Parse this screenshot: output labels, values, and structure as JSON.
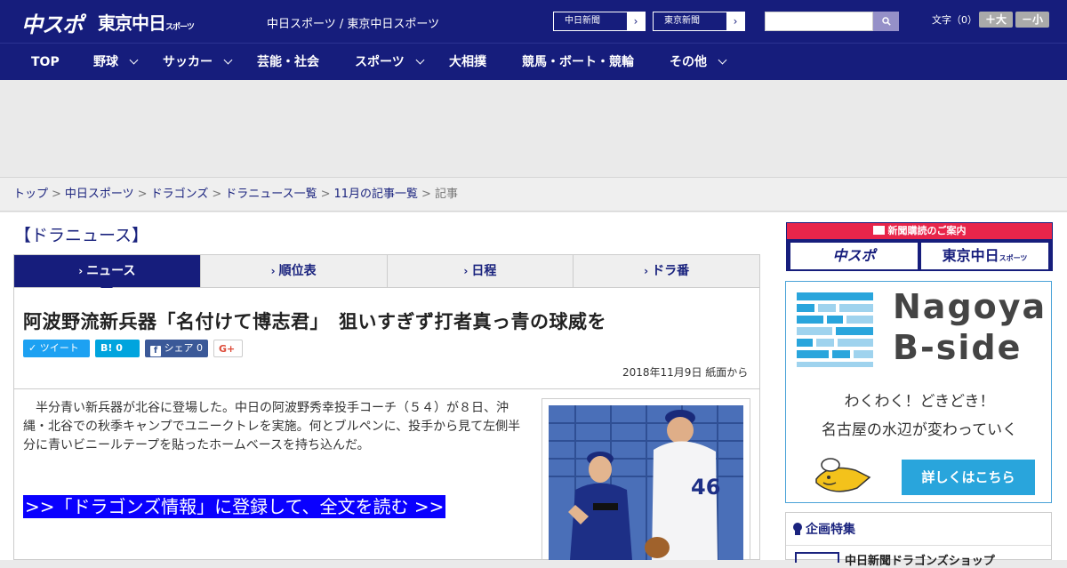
{
  "header": {
    "logo_main": "中スポ",
    "logo_tokyo": "東京中日",
    "logo_tokyo_small": "スポーツ",
    "site_names": "中日スポーツ / 東京中日スポーツ",
    "ext_links": [
      {
        "label": "中日新聞"
      },
      {
        "label": "東京新聞"
      }
    ],
    "search": {
      "placeholder": "",
      "button_icon": "search-icon"
    },
    "font_size": {
      "label": "文字（0）",
      "bigger": "＋大",
      "smaller": "－小"
    }
  },
  "nav": {
    "items": [
      {
        "label": "TOP",
        "has_dropdown": false
      },
      {
        "label": "野球",
        "has_dropdown": true
      },
      {
        "label": "サッカー",
        "has_dropdown": true
      },
      {
        "label": "芸能・社会",
        "has_dropdown": false
      },
      {
        "label": "スポーツ",
        "has_dropdown": true
      },
      {
        "label": "大相撲",
        "has_dropdown": false
      },
      {
        "label": "競馬・ボート・競輪",
        "has_dropdown": false
      },
      {
        "label": "その他",
        "has_dropdown": true
      }
    ]
  },
  "breadcrumb": {
    "items": [
      {
        "label": "トップ"
      },
      {
        "label": "中日スポーツ"
      },
      {
        "label": "ドラゴンズ"
      },
      {
        "label": "ドラニュース一覧"
      },
      {
        "label": "11月の記事一覧"
      }
    ],
    "separator": ">",
    "current": "記事"
  },
  "section": {
    "title": "【ドラニュース】"
  },
  "tabs": [
    {
      "label": "ニュース",
      "active": true
    },
    {
      "label": "順位表",
      "active": false
    },
    {
      "label": "日程",
      "active": false
    },
    {
      "label": "ドラ番",
      "active": false
    }
  ],
  "article": {
    "headline": "阿波野流新兵器「名付けて博志君」　狙いすぎず打者真っ青の球威を",
    "share": {
      "tweet": "ツイート",
      "hatena": "B! 0",
      "facebook": "シェア 0",
      "gplus": "G+"
    },
    "date": "2018年11月9日 紙面から",
    "body": "　半分青い新兵器が北谷に登場した。中日の阿波野秀幸投手コーチ（５４）が８日、沖縄・北谷での秋季キャンプでユニークトレを実施。何とブルペンに、投手から見て左側半分に青いビニールテープを貼ったホームベースを持ち込んだ。",
    "cta": ">>「ドラゴンズ情報」に登録して、全文を読む >>",
    "photo_number": "46"
  },
  "sidebar": {
    "subscription": {
      "header": "新聞購読のご案内",
      "left": "中スポ",
      "right": "東京中日",
      "right_small": "スポーツ"
    },
    "ad": {
      "title_line1": "Nagoya",
      "title_line2": "B-side",
      "tagline1": "わくわく！どきどき！",
      "tagline2": "名古屋の水辺が変わっていく",
      "button": "詳しくはこちら"
    },
    "feature": {
      "header": "企画特集",
      "item": "中日新聞ドラゴンズショップ"
    }
  },
  "colors": {
    "brand_navy": "#161d7c",
    "accent_red": "#e8254a",
    "cta_blue": "#0a00ff",
    "ad_blue": "#29a5dc"
  }
}
